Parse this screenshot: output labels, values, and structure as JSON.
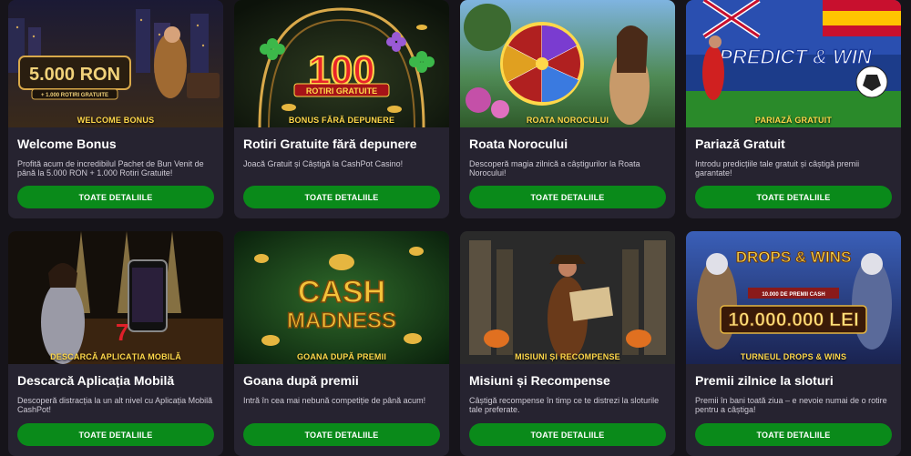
{
  "button_label": "TOATE DETALIILE",
  "colors": {
    "background": "#16141a",
    "card": "#262330",
    "button": "#0a8a1a",
    "label": "#ffd84a"
  },
  "promotions": [
    {
      "banner_label": "WELCOME BONUS",
      "banner_text": "5.000 RON",
      "banner_subtext": "+ 1.000 ROTIRI GRATUITE",
      "title": "Welcome Bonus",
      "description": "Profită acum de incredibilul Pachet de Bun Venit de până la 5.000 RON + 1.000 Rotiri Gratuite!",
      "image": "woman-with-money-bag-night-city"
    },
    {
      "banner_label": "BONUS FĂRĂ DEPUNERE",
      "banner_text": "100",
      "banner_subtext": "ROTIRI GRATUITE",
      "title": "Rotiri Gratuite fără depunere",
      "description": "Joacă Gratuit și Câștigă la CashPot Casino!",
      "image": "golden-arch-clovers"
    },
    {
      "banner_label": "ROATA NOROCULUI",
      "title": "Roata Norocului",
      "description": "Descoperă magia zilnică a câștigurilor la Roata Norocului!",
      "image": "fortune-wheel-woman-garden"
    },
    {
      "banner_label": "PARIAZĂ GRATUIT",
      "banner_text": "PREDICT & WIN",
      "title": "Pariază Gratuit",
      "description": "Introdu predicțiile tale gratuit și câștigă premii garantate!",
      "image": "football-player-flags"
    },
    {
      "banner_label": "DESCARCĂ APLICAȚIA MOBILĂ",
      "title": "Descarcă Aplicația Mobilă",
      "description": "Descoperă distracția la un alt nivel cu Aplicația Mobilă CashPot!",
      "image": "woman-with-phone-stage"
    },
    {
      "banner_label": "GOANA DUPĂ PREMII",
      "banner_text": "CASH MADNESS",
      "title": "Goana după premii",
      "description": "Intră în cea mai nebună competiție de până acum!",
      "image": "gold-coins-cash-madness"
    },
    {
      "banner_label": "MISIUNI ȘI RECOMPENSE",
      "title": "Misiuni și Recompense",
      "description": "Câștigă recompense în timp ce te distrezi la sloturile tale preferate.",
      "image": "explorer-with-map-temple"
    },
    {
      "banner_label": "TURNEUL DROPS & WINS",
      "banner_text": "DROPS & WINS",
      "banner_subtext": "10.000.000 LEI",
      "banner_small": "10.000 DE PREMII CASH",
      "title": "Premii zilnice la sloturi",
      "description": "Premii în bani toată ziua – e nevoie numai de o rotire pentru a câștiga!",
      "image": "gods-drops-and-wins"
    }
  ]
}
